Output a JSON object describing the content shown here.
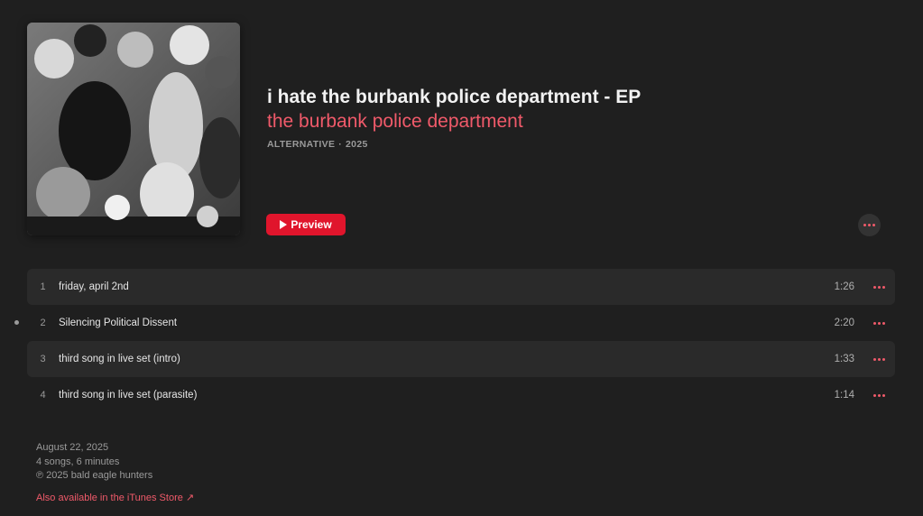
{
  "album": {
    "title": "i hate the burbank police department - EP",
    "artist": "the burbank police department",
    "genre": "ALTERNATIVE",
    "separator": "·",
    "year": "2025",
    "art_icon": "album-cover-photo"
  },
  "actions": {
    "preview_label": "Preview",
    "play_icon": "play-icon",
    "more_icon": "more-icon"
  },
  "tracks": [
    {
      "number": "1",
      "title": "friday, april 2nd",
      "duration": "1:26"
    },
    {
      "number": "2",
      "title": "Silencing Political Dissent",
      "duration": "2:20"
    },
    {
      "number": "3",
      "title": "third song in live set (intro)",
      "duration": "1:33"
    },
    {
      "number": "4",
      "title": "third song in live set (parasite)",
      "duration": "1:14"
    }
  ],
  "footer": {
    "release_date": "August 22, 2025",
    "summary": "4 songs, 6 minutes",
    "copyright": "℗ 2025 bald eagle hunters",
    "store_link": "Also available in the iTunes Store",
    "store_link_icon": "↗"
  },
  "colors": {
    "accent": "#f05a6a",
    "button": "#e0152c",
    "background": "#1f1f1f"
  }
}
